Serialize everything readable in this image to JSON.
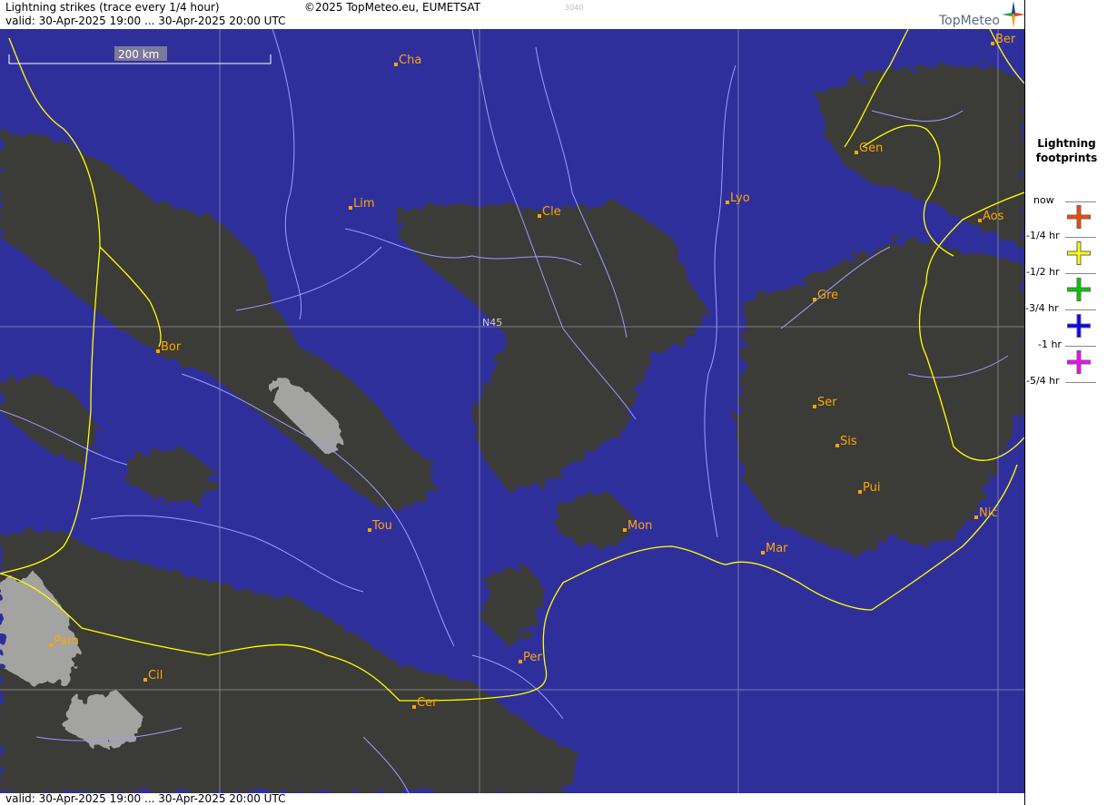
{
  "header": {
    "title": "Lightning strikes (trace every 1/4 hour)",
    "valid": "valid:  30-Apr-2025 19:00 ... 30-Apr-2025 20:00 UTC",
    "copyright": "©2025 TopMeteo.eu, EUMETSAT",
    "code": "3040",
    "logo": "TopMeteo"
  },
  "footer": {
    "valid": "valid:  30-Apr-2025 19:00 ... 30-Apr-2025 20:00 UTC"
  },
  "map": {
    "scale_label": "200 km",
    "lat_label": "N45",
    "colors": {
      "sea_clear": "#2f2f9c",
      "cloud": "#3a3a38",
      "bright_cloud": "#bdbdbd",
      "border": "#ffff00",
      "river": "#9c9cff",
      "city_label": "#ffa500"
    },
    "cities": [
      {
        "name": "Cha"
      },
      {
        "name": "Ber"
      },
      {
        "name": "Gen"
      },
      {
        "name": "Lim"
      },
      {
        "name": "Cle"
      },
      {
        "name": "Lyo"
      },
      {
        "name": "Aos"
      },
      {
        "name": "Gre"
      },
      {
        "name": "Bor"
      },
      {
        "name": "Ser"
      },
      {
        "name": "Sis"
      },
      {
        "name": "Pui"
      },
      {
        "name": "Tou"
      },
      {
        "name": "Mon"
      },
      {
        "name": "Mar"
      },
      {
        "name": "Nic"
      },
      {
        "name": "Pam"
      },
      {
        "name": "Cil"
      },
      {
        "name": "Per"
      },
      {
        "name": "Cer"
      }
    ]
  },
  "legend": {
    "title_line1": "Lightning",
    "title_line2": "footprints",
    "entries": [
      {
        "label": "now",
        "color": ""
      },
      {
        "label": "-1/4 hr",
        "color": "#ff4500"
      },
      {
        "label": "-1/2 hr",
        "color": "#ffff00"
      },
      {
        "label": "-3/4 hr",
        "color": "#00cc00"
      },
      {
        "label": "-1 hr",
        "color": "#0000ff"
      },
      {
        "label": "-5/4 hr",
        "color": "#ff00ff"
      }
    ]
  }
}
